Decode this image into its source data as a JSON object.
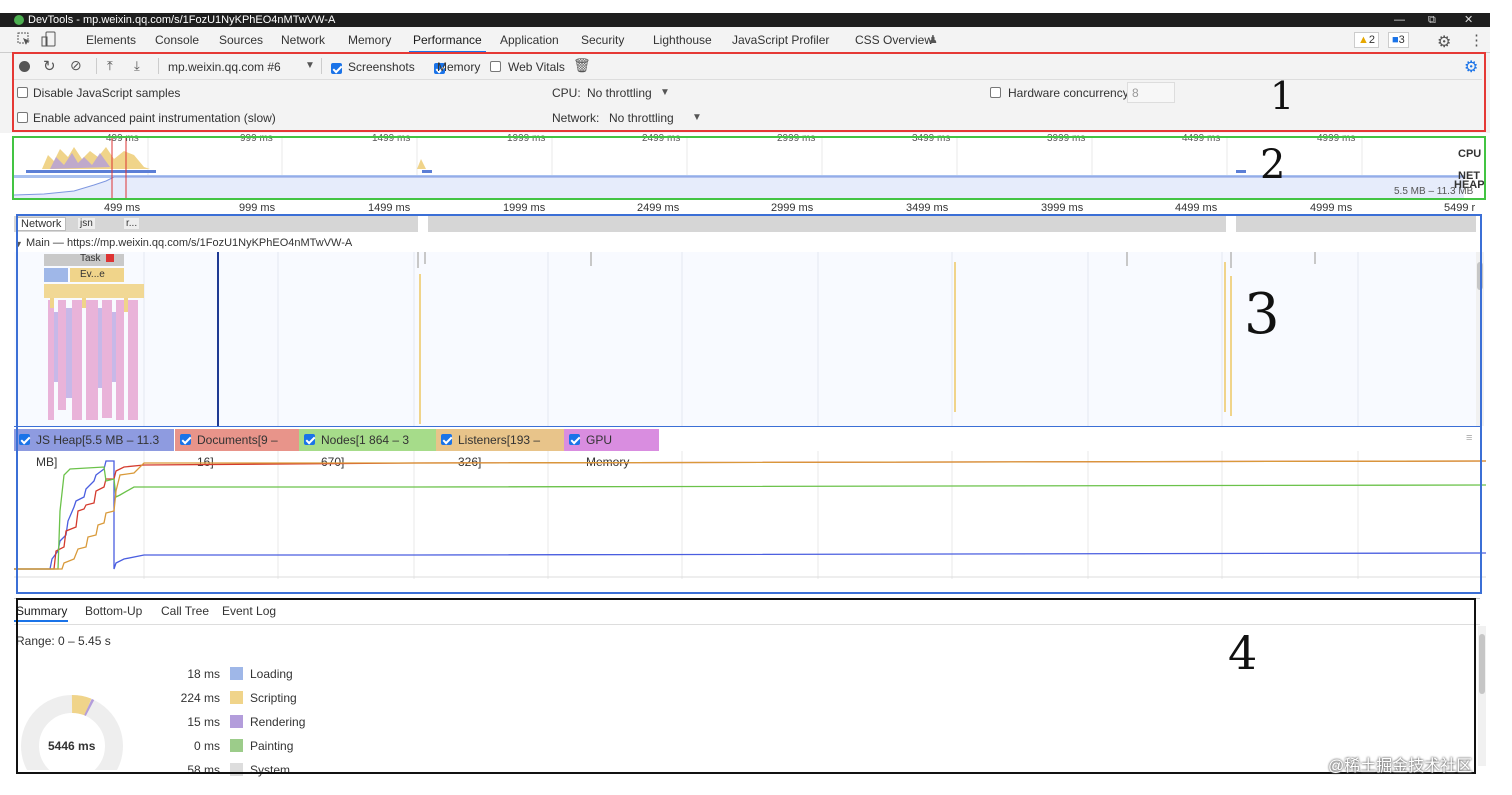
{
  "window": {
    "title": "DevTools - mp.weixin.qq.com/s/1FozU1NyKPhEO4nMTwVW-A",
    "controls": [
      "—",
      "⧉",
      "✕"
    ]
  },
  "tabs": [
    "Elements",
    "Console",
    "Sources",
    "Network",
    "Memory",
    "Performance",
    "Application",
    "Security",
    "Lighthouse",
    "JavaScript Profiler",
    "CSS Overview"
  ],
  "active_tab": "Performance",
  "badges": {
    "warnings": "2",
    "messages": "3"
  },
  "toolbar": {
    "profile_select": "mp.weixin.qq.com #6",
    "screenshots_label": "Screenshots",
    "memory_label": "Memory",
    "web_vitals_label": "Web Vitals",
    "disable_js_samples": "Disable JavaScript samples",
    "advanced_paint": "Enable advanced paint instrumentation (slow)",
    "cpu_label": "CPU:",
    "cpu_value": "No throttling",
    "network_label": "Network:",
    "network_value": "No throttling",
    "hw_concurrency_label": "Hardware concurrency",
    "hw_concurrency_value": "8"
  },
  "overview": {
    "ticks": [
      "499 ms",
      "999 ms",
      "1499 ms",
      "1999 ms",
      "2499 ms",
      "2999 ms",
      "3499 ms",
      "3999 ms",
      "4499 ms",
      "4999 ms",
      "5499 r"
    ],
    "top_ticks": [
      "499 ms",
      "999 ms",
      "1499 ms",
      "1999 ms",
      "2499 ms",
      "2999 ms",
      "3499 ms",
      "3999 ms",
      "4499 ms",
      "4999 ms"
    ],
    "lanes": [
      "CPU",
      "NET",
      "HEAP"
    ],
    "heap_range": "5.5 MB – 11.3 MB"
  },
  "tracks": {
    "network_label": "Network",
    "network_items": [
      "jsn",
      "r..."
    ],
    "main_label": "Main — https://mp.weixin.qq.com/s/1FozU1NyKPhEO4nMTwVW-A",
    "flame_items": [
      "Task",
      "Ev...e"
    ]
  },
  "memory_legend": [
    {
      "label": "JS Heap[5.5 MB – 11.3 MB]",
      "color": "#8e9be0"
    },
    {
      "label": "Documents[9 – 16]",
      "color": "#e8948a"
    },
    {
      "label": "Nodes[1 864 – 3 670]",
      "color": "#a6dc8a"
    },
    {
      "label": "Listeners[193 – 326]",
      "color": "#e8c48a"
    },
    {
      "label": "GPU Memory",
      "color": "#d98de0"
    }
  ],
  "bottom_tabs": [
    "Summary",
    "Bottom-Up",
    "Call Tree",
    "Event Log"
  ],
  "summary": {
    "range": "Range: 0 – 5.45 s",
    "total": "5446 ms",
    "rows": [
      {
        "value": "18 ms",
        "label": "Loading",
        "color": "#9fb7e8"
      },
      {
        "value": "224 ms",
        "label": "Scripting",
        "color": "#f0d48a"
      },
      {
        "value": "15 ms",
        "label": "Rendering",
        "color": "#b39ddb"
      },
      {
        "value": "0 ms",
        "label": "Painting",
        "color": "#9ccc8a"
      },
      {
        "value": "58 ms",
        "label": "System",
        "color": "#dddddd"
      }
    ]
  },
  "annotations": [
    "1",
    "2",
    "3",
    "4"
  ],
  "watermark": "@稀土掘金技术社区"
}
